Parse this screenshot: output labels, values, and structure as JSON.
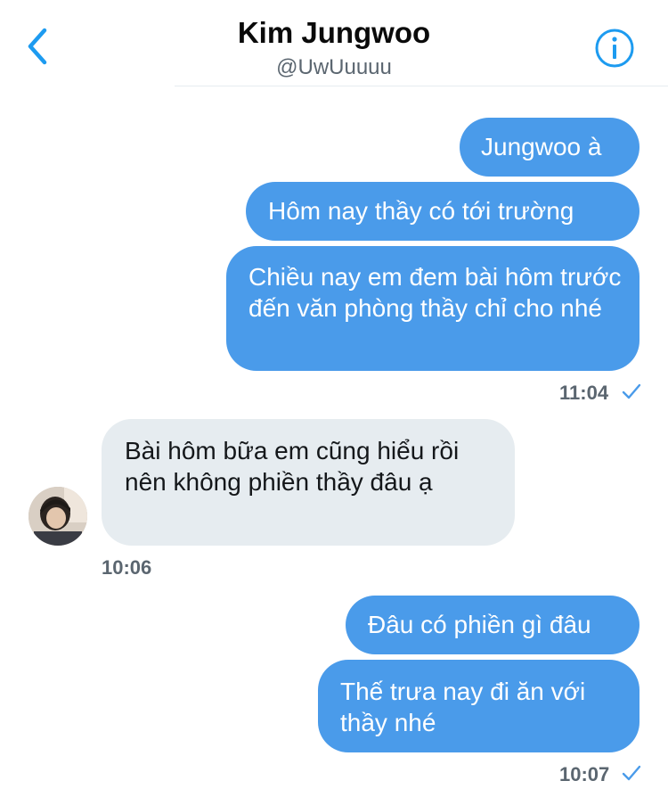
{
  "header": {
    "name": "Kim Jungwoo",
    "handle": "@UwUuuuu"
  },
  "messages": [
    {
      "text": "Jungwoo à"
    },
    {
      "text": "Hôm nay thầy có tới trường"
    },
    {
      "text": "Chiều nay em đem bài hôm trước đến văn phòng thầy chỉ cho nhé"
    },
    {
      "text": "Bài hôm bữa em cũng hiểu rồi nên không phiền thầy đâu ạ"
    },
    {
      "text": "Đâu có phiền gì đâu"
    },
    {
      "text": "Thế trưa nay đi ăn với thầy nhé"
    }
  ],
  "timestamps": {
    "first": "11:04",
    "second": "10:06",
    "third": "10:07"
  },
  "colors": {
    "outgoing_bubble": "#4a9bea",
    "incoming_bubble": "#e6ecf0",
    "accent": "#1d9bf0"
  }
}
